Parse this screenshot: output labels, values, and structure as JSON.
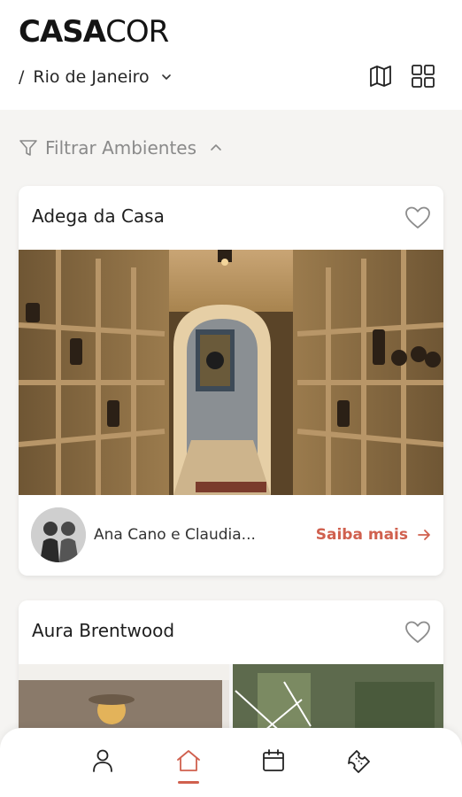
{
  "header": {
    "logo_bold": "CASA",
    "logo_thin": "COR",
    "breadcrumb_separator": "/",
    "city": "Rio de Janeiro",
    "map_icon": "map-icon",
    "grid_icon": "grid-icon"
  },
  "filter": {
    "label": "Filtrar Ambientes",
    "icon": "filter-icon",
    "chevron": "chevron-up-icon"
  },
  "cards": [
    {
      "title": "Adega da Casa",
      "designers": "Ana Cano e Claudia...",
      "cta": "Saiba mais",
      "favorite_icon": "heart-outline-icon"
    },
    {
      "title": "Aura Brentwood",
      "favorite_icon": "heart-outline-icon"
    }
  ],
  "bottom_nav": {
    "items": [
      "profile-icon",
      "home-icon",
      "calendar-icon",
      "tickets-icon"
    ],
    "active": "home-icon",
    "accent_color": "#d0604e"
  }
}
